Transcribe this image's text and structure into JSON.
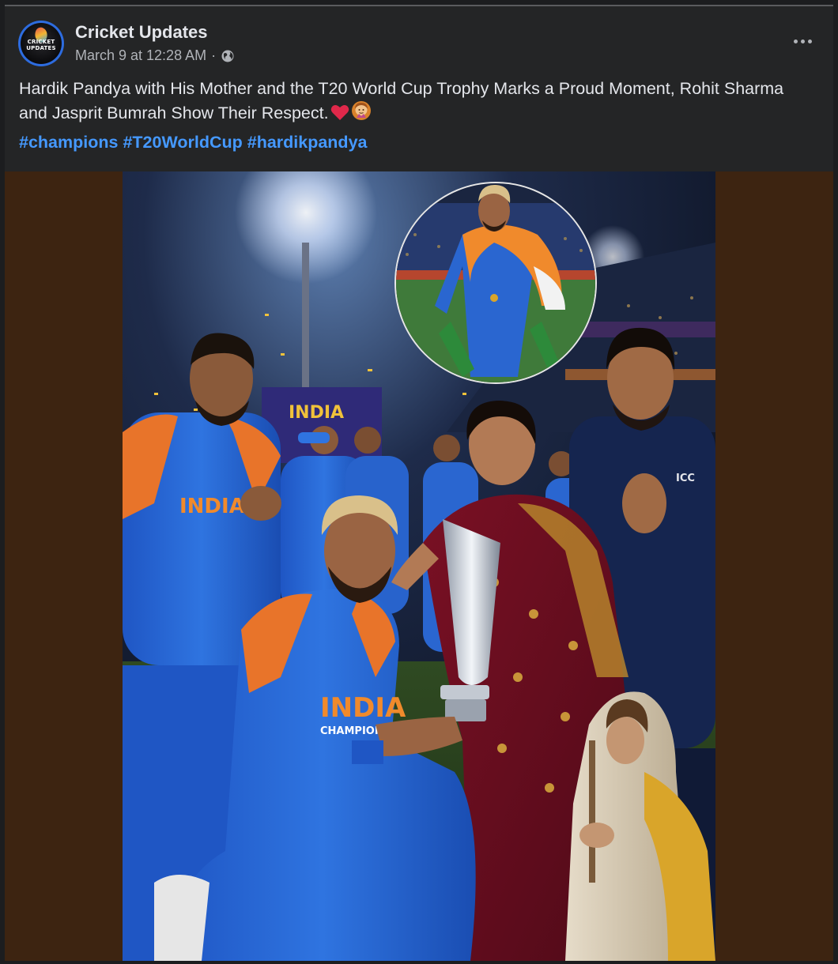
{
  "post": {
    "author": "Cricket Updates",
    "avatar_text": "CRICKET UPDATES",
    "timestamp": "March 9 at 12:28 AM",
    "separator": "·",
    "audience_icon": "globe-icon",
    "more_icon": "more-horizontal-icon",
    "text": "Hardik Pandya with His Mother and the T20 World Cup Trophy Marks a Proud Moment, Rohit Sharma and Jasprit Bumrah Show Their Respect.",
    "emojis": [
      "heart-emoji",
      "woman-gesturing-emoji"
    ],
    "hashtags": [
      "#champions",
      "#T20WorldCup",
      "#hardikpandya"
    ],
    "photo": {
      "jersey_text": "INDIA",
      "jersey_sub": "CHAMPIONS",
      "board_text": "INDIA",
      "shirt_logo": "ICC"
    }
  },
  "colors": {
    "card_bg": "#242526",
    "text_primary": "#e4e6eb",
    "text_secondary": "#b0b3b8",
    "hashtag": "#4599ff",
    "media_bg": "#3d2411"
  }
}
